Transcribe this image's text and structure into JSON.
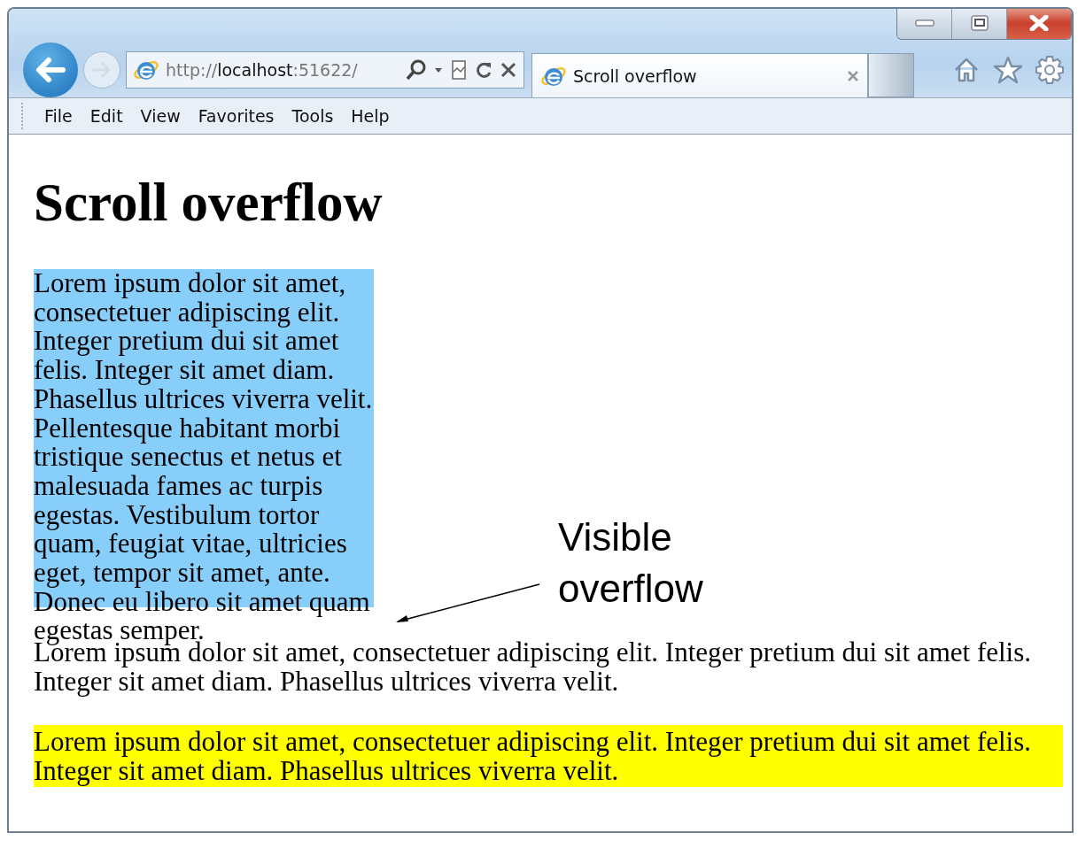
{
  "browser": {
    "address": "http://**localhost**:51622/",
    "tab_title": "Scroll overflow",
    "menu": [
      "File",
      "Edit",
      "View",
      "Favorites",
      "Tools",
      "Help"
    ]
  },
  "page": {
    "heading": "Scroll overflow",
    "overflow_box": "Lorem ipsum dolor sit amet, consectetuer adipiscing elit. Integer pretium dui sit amet felis. Integer sit amet diam. Phasellus ultrices viverra velit. Pellentesque habitant morbi tristique senectus et netus et malesuada fames ac turpis egestas. Vestibulum tortor quam, feugiat vitae, ultricies eget, tempor sit amet, ante. Donec eu libero sit amet quam egestas semper.",
    "paragraph": "Lorem ipsum dolor sit amet, consectetuer adipiscing elit. Integer pretium dui sit amet felis. Integer sit amet diam. Phasellus ultrices viverra velit.",
    "highlighted_paragraph": "Lorem ipsum dolor sit amet, consectetuer adipiscing elit. Integer pretium dui sit amet felis. Integer sit amet diam. Phasellus ultrices viverra velit."
  },
  "annotation": "Visible overflow"
}
